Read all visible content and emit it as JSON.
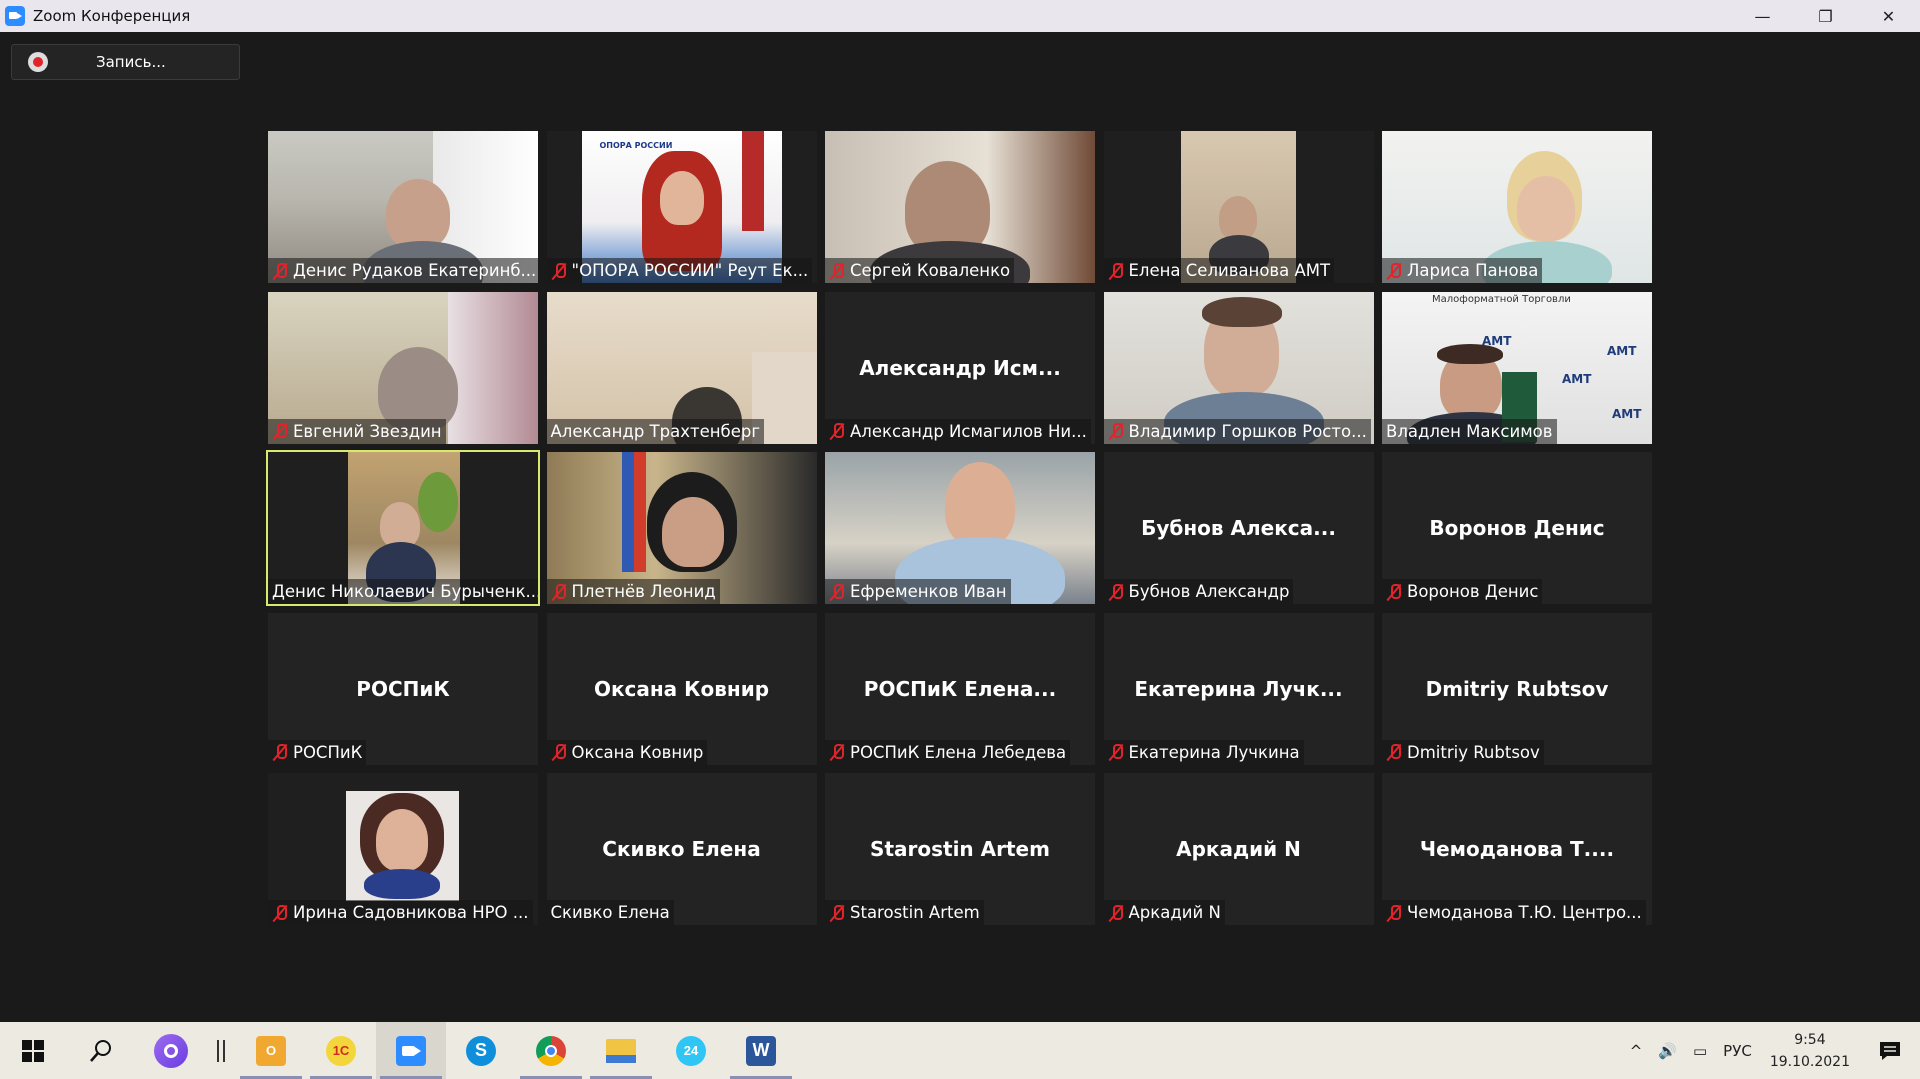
{
  "window": {
    "title": "Zoom Конференция",
    "minimize": "—",
    "restore": "❐",
    "close": "✕"
  },
  "record": {
    "label": "Запись..."
  },
  "tiles": [
    {
      "label": "Денис Рудаков Екатеринб...",
      "muted": true,
      "big": ""
    },
    {
      "label": "\"ОПОРА РОССИИ\" Реут Ек...",
      "muted": true,
      "big": ""
    },
    {
      "label": "Сергей Коваленко",
      "muted": true,
      "big": ""
    },
    {
      "label": "Елена Селиванова АМТ",
      "muted": true,
      "big": ""
    },
    {
      "label": "Лариса Панова",
      "muted": true,
      "big": ""
    },
    {
      "label": "Евгений Звездин",
      "muted": true,
      "big": ""
    },
    {
      "label": "Александр Трахтенберг",
      "muted": false,
      "big": ""
    },
    {
      "label": "Александр Исмагилов Ни...",
      "muted": true,
      "big": "Александр  Исм..."
    },
    {
      "label": "Владимир Горшков Росто...",
      "muted": true,
      "big": ""
    },
    {
      "label": "Владлен Максимов",
      "muted": false,
      "big": ""
    },
    {
      "label": "Денис Николаевич Бурыченк...",
      "muted": false,
      "big": ""
    },
    {
      "label": "Плетнёв Леонид",
      "muted": true,
      "big": ""
    },
    {
      "label": "Ефременков Иван",
      "muted": true,
      "big": ""
    },
    {
      "label": "Бубнов Александр",
      "muted": true,
      "big": "Бубнов  Алекса..."
    },
    {
      "label": "Воронов Денис",
      "muted": true,
      "big": "Воронов Денис"
    },
    {
      "label": "РОСПиК",
      "muted": true,
      "big": "РОСПиК"
    },
    {
      "label": "Оксана Ковнир",
      "muted": true,
      "big": "Оксана Ковнир"
    },
    {
      "label": "РОСПиК Елена Лебедева",
      "muted": true,
      "big": "РОСПиК  Елена..."
    },
    {
      "label": "Екатерина Лучкина",
      "muted": true,
      "big": "Екатерина  Лучк..."
    },
    {
      "label": "Dmitriy Rubtsov",
      "muted": true,
      "big": "Dmitriy Rubtsov"
    },
    {
      "label": "Ирина Садовникова НРО ...",
      "muted": true,
      "big": ""
    },
    {
      "label": "Скивко Елена",
      "muted": false,
      "big": "Скивко Елена"
    },
    {
      "label": "Starostin Artem",
      "muted": true,
      "big": "Starostin Artem"
    },
    {
      "label": "Аркадий N",
      "muted": true,
      "big": "Аркадий N"
    },
    {
      "label": "Чемоданова Т.Ю. Центро...",
      "muted": true,
      "big": "Чемоданова  Т...."
    }
  ],
  "tile_video_text": {
    "opora": "ОПОРА РОССИИ",
    "amt": "АМТ",
    "amt_banner": "Малоформатной Торговли"
  },
  "taskbar": {
    "apps": [
      "windows-start",
      "search",
      "cortana",
      "task-view",
      "outlook",
      "1c",
      "zoom",
      "skype",
      "chrome",
      "explorer",
      "bitrix24",
      "word"
    ],
    "app_glyphs": {
      "outlook": "O",
      "1c": "1С",
      "skype": "S",
      "bitrix24": "24",
      "word": "W"
    },
    "tray": {
      "chevron": "^",
      "volume": "🔊",
      "network": "▭",
      "lang": "РУС"
    },
    "time": "9:54",
    "date": "19.10.2021"
  }
}
